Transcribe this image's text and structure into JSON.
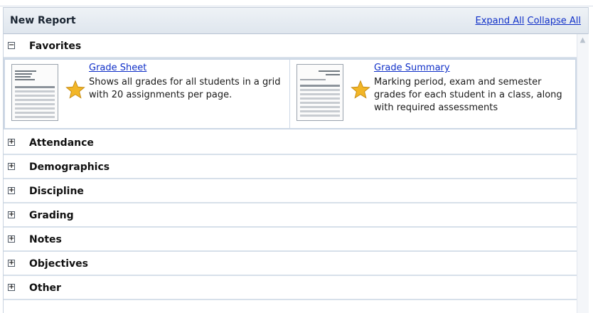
{
  "header": {
    "title": "New Report",
    "expand_all": "Expand All",
    "collapse_all": "Collapse All"
  },
  "favorites": {
    "label": "Favorites",
    "toggle_symbol": "−",
    "cards": [
      {
        "link": "Grade Sheet",
        "description": "Shows all grades for all students in a grid with 20 assignments per page.",
        "thumb_icon": "report-thumbnail-icon"
      },
      {
        "link": "Grade Summary",
        "description": "Marking period, exam and semester grades for each student in a class, along with required assessments",
        "thumb_icon": "report-thumbnail-icon"
      }
    ]
  },
  "sections": [
    {
      "label": "Attendance",
      "toggle_symbol": "+"
    },
    {
      "label": "Demographics",
      "toggle_symbol": "+"
    },
    {
      "label": "Discipline",
      "toggle_symbol": "+"
    },
    {
      "label": "Grading",
      "toggle_symbol": "+"
    },
    {
      "label": "Notes",
      "toggle_symbol": "+"
    },
    {
      "label": "Objectives",
      "toggle_symbol": "+"
    },
    {
      "label": "Other",
      "toggle_symbol": "+"
    }
  ],
  "colors": {
    "link": "#1030c8",
    "star": "#f2b627",
    "header_bg": "#e3e9f0",
    "divider": "#d7e0ea"
  }
}
